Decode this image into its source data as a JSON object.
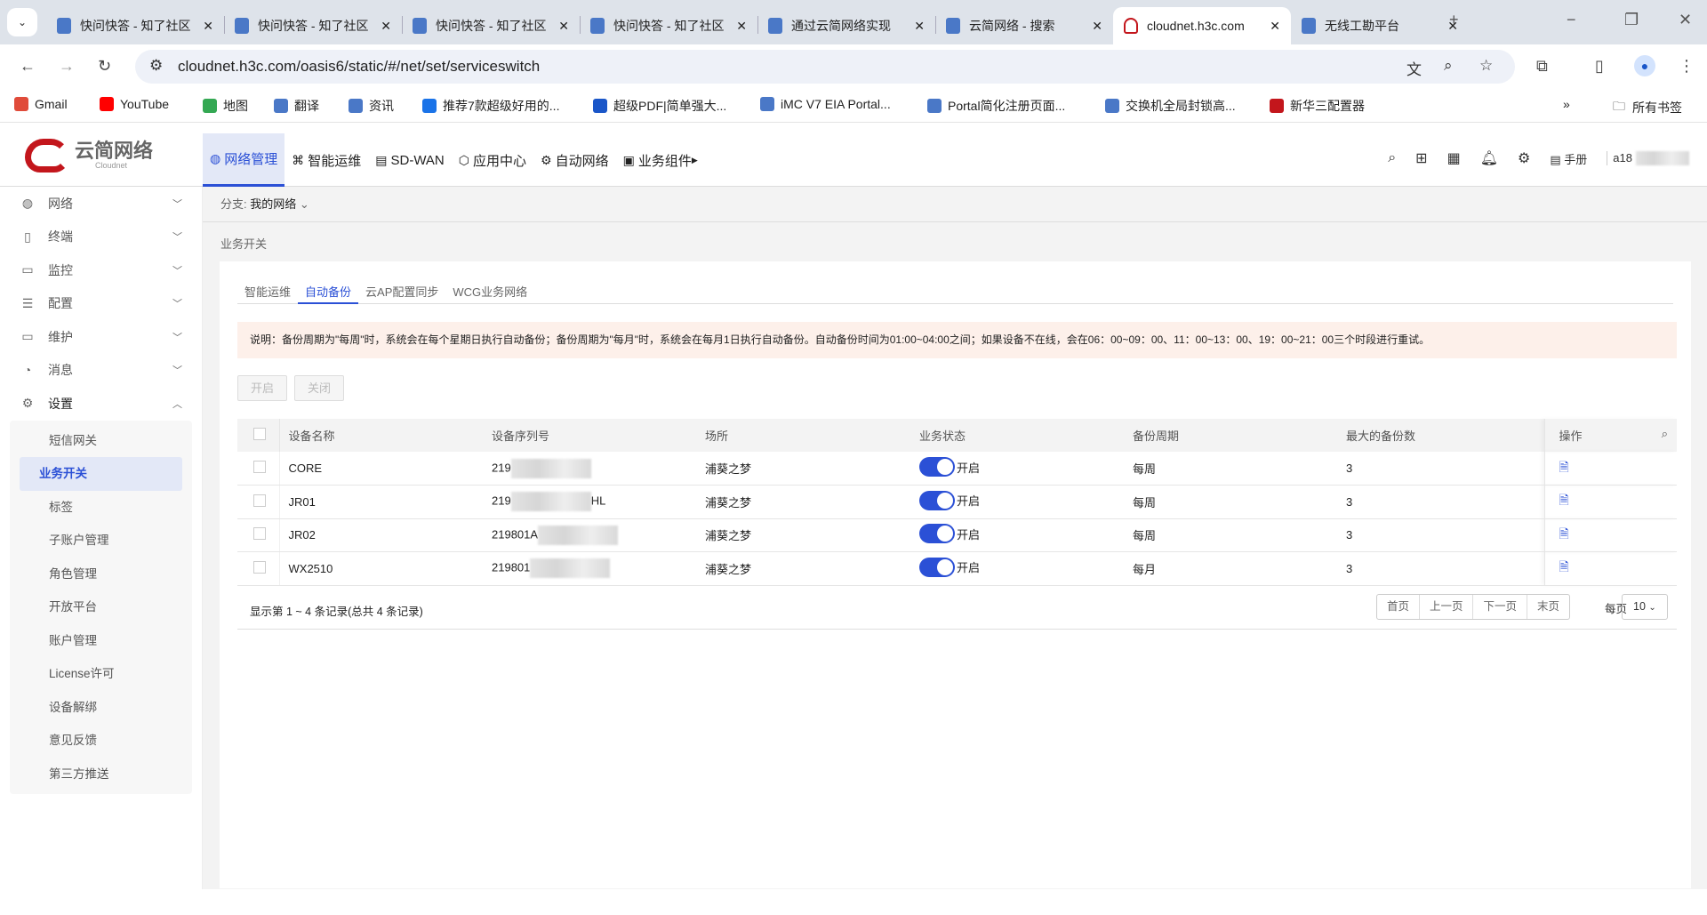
{
  "browser": {
    "tabs": [
      {
        "title": "快问快答 - 知了社区",
        "active": false
      },
      {
        "title": "快问快答 - 知了社区",
        "active": false
      },
      {
        "title": "快问快答 - 知了社区",
        "active": false
      },
      {
        "title": "快问快答 - 知了社区",
        "active": false
      },
      {
        "title": "通过云简网络实现",
        "active": false
      },
      {
        "title": "云简网络 - 搜索",
        "active": false
      },
      {
        "title": "cloudnet.h3c.com",
        "active": true
      },
      {
        "title": "无线工勘平台",
        "active": false
      }
    ],
    "url": "cloudnet.h3c.com/oasis6/static/#/net/set/serviceswitch",
    "bookmarks": [
      "Gmail",
      "YouTube",
      "地图",
      "翻译",
      "资讯",
      "推荐7款超级好用的...",
      "超级PDF|简单强大...",
      "iMC V7 EIA Portal...",
      "Portal简化注册页面...",
      "交换机全局封锁高...",
      "新华三配置器"
    ],
    "all_bookmarks": "所有书签"
  },
  "app": {
    "logo_text": "云简网络",
    "logo_sub": "Cloudnet",
    "topnav": [
      "网络管理",
      "智能运维",
      "SD-WAN",
      "应用中心",
      "自动网络",
      "业务组件"
    ],
    "manual": "手册",
    "user": "a18"
  },
  "sidebar": {
    "items": [
      {
        "label": "网络",
        "icon": "globe-icon"
      },
      {
        "label": "终端",
        "icon": "phone-icon"
      },
      {
        "label": "监控",
        "icon": "monitor-icon"
      },
      {
        "label": "配置",
        "icon": "sliders-icon"
      },
      {
        "label": "维护",
        "icon": "monitor-icon"
      },
      {
        "label": "消息",
        "icon": "bell-icon"
      },
      {
        "label": "设置",
        "icon": "gear-icon"
      }
    ],
    "sub_items": [
      "短信网关",
      "业务开关",
      "标签",
      "子账户管理",
      "角色管理",
      "开放平台",
      "账户管理",
      "License许可",
      "设备解绑",
      "意见反馈",
      "第三方推送"
    ],
    "active_sub": "业务开关"
  },
  "main": {
    "branch_label": "分支:",
    "branch_value": "我的网络",
    "breadcrumb": "业务开关",
    "tabs": [
      "智能运维",
      "自动备份",
      "云AP配置同步",
      "WCG业务网络"
    ],
    "active_tab": "自动备份",
    "notice": "说明：备份周期为\"每周\"时，系统会在每个星期日执行自动备份；备份周期为\"每月\"时，系统会在每月1日执行自动备份。自动备份时间为01:00~04:00之间；如果设备不在线，会在06：00~09：00、11：00~13：00、19：00~21：00三个时段进行重试。",
    "btn_on": "开启",
    "btn_off": "关闭",
    "columns": [
      "设备名称",
      "设备序列号",
      "场所",
      "业务状态",
      "备份周期",
      "最大的备份数",
      "操作"
    ],
    "rows": [
      {
        "name": "CORE",
        "serial_prefix": "219",
        "serial_suffix": "",
        "place": "浦葵之梦",
        "status": "开启",
        "cycle": "每周",
        "max": "3"
      },
      {
        "name": "JR01",
        "serial_prefix": "219",
        "serial_suffix": "HL",
        "place": "浦葵之梦",
        "status": "开启",
        "cycle": "每周",
        "max": "3"
      },
      {
        "name": "JR02",
        "serial_prefix": "219801A",
        "serial_suffix": "",
        "place": "浦葵之梦",
        "status": "开启",
        "cycle": "每周",
        "max": "3"
      },
      {
        "name": "WX2510",
        "serial_prefix": "219801",
        "serial_suffix": "",
        "place": "浦葵之梦",
        "status": "开启",
        "cycle": "每月",
        "max": "3"
      }
    ],
    "footer_info": "显示第 1 ~ 4 条记录(总共 4 条记录)",
    "pager": [
      "首页",
      "上一页",
      "下一页",
      "末页"
    ],
    "per_page_label": "每页",
    "per_page": "10"
  },
  "colors": {
    "accent": "#2b50d6",
    "notice_bg": "#fdf0ea",
    "brand": "#c3161c"
  }
}
